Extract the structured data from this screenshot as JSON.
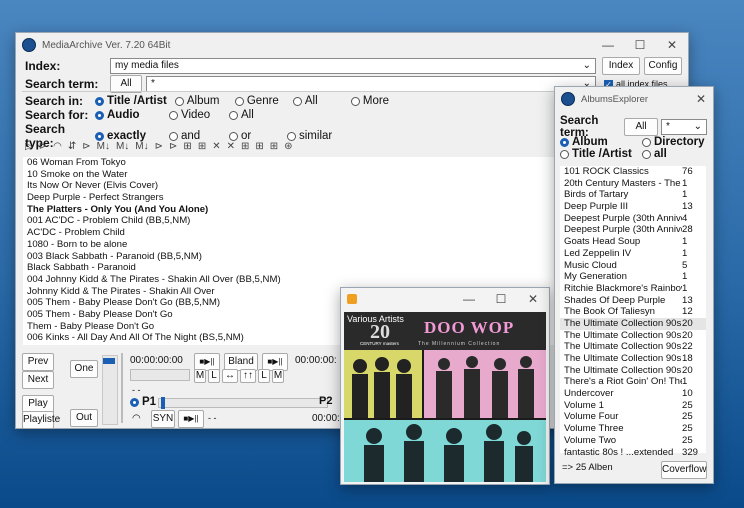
{
  "main": {
    "title": "MediaArchive Ver. 7.20 64Bit",
    "index_label": "Index:",
    "index_value": "my media files",
    "index_btn": "Index",
    "config_btn": "Config",
    "search_term_label": "Search term:",
    "all_btn": "All",
    "search_value": "*",
    "all_index_files": "all index files",
    "search_in_label": "Search in:",
    "search_for_label": "Search for:",
    "search_type_label": "Search type:",
    "search_in": [
      "Title /Artist",
      "Album",
      "Genre",
      "All",
      "More"
    ],
    "search_for": [
      "Audio",
      "Video",
      "All"
    ],
    "search_type": [
      "exactly",
      "and",
      "or",
      "similar"
    ],
    "toolbar_glyphs": [
      "▷",
      "⊳",
      "◠",
      "⇵",
      "⊳",
      "M↓",
      "M↓",
      "M↓",
      "⊳",
      "⊳",
      "⊞",
      "⊞",
      "✕",
      "✕",
      "⊞",
      "⊞",
      "⊞",
      "⊛"
    ],
    "results": [
      "06 Woman From Tokyo",
      "10 Smoke on the Water",
      "Its Now Or Never (Elvis Cover)",
      "Deep Purple - Perfect Strangers",
      "The Platters - Only You (And You Alone)",
      "001  AC'DC - Problem Child (BB,5,NM)",
      "AC'DC - Problem Child",
      "1080 - Born to be alone",
      "003  Black Sabbath - Paranoid (BB,5,NM)",
      "Black Sabbath - Paranoid",
      "004  Johnny Kidd & The Pirates - Shakin All Over (BB,5,NM)",
      "Johnny Kidd & The Pirates - Shakin All Over",
      "005  Them - Baby Please Don't Go (BB,5,NM)",
      "005  Them - Baby Please Don't Go",
      "Them - Baby Please Don't Go",
      "006  Kinks - All Day And All Of The Night (BS,5,NM)"
    ],
    "player": {
      "prev": "Prev",
      "next": "Next",
      "play": "Play",
      "playlist": "Playliste",
      "one": "One",
      "out": "Out",
      "time1": "00:00:00:00",
      "time2": "00:00:00:",
      "bland": "Bland",
      "m": "M",
      "l": "L",
      "lr": "↔",
      "up": "↑↑",
      "l2": "L",
      "m2": "M",
      "dashes": "- -",
      "p1": "P1",
      "p2": "P2",
      "syn": "SYN",
      "dashes2": "- -",
      "time3": "00:00:00:",
      "playpause": "■▶||"
    }
  },
  "albums": {
    "title": "AlbumsExplorer",
    "search_term_label": "Search term:",
    "all_btn": "All",
    "search_value": "*",
    "opt_album": "Album",
    "opt_directory": "Directory",
    "opt_title_artist": "Title /Artist",
    "opt_all": "all",
    "items": [
      [
        "101 ROCK Classics",
        "76"
      ],
      [
        "20th Century Masters - The Mille",
        "1"
      ],
      [
        "Birds of Tartary",
        "1"
      ],
      [
        "Deep Purple III",
        "13"
      ],
      [
        "Deepest Purple (30th Anniversa",
        "4"
      ],
      [
        "Deepest Purple (30th Anniversar",
        "28"
      ],
      [
        "Goats Head Soup",
        "1"
      ],
      [
        "Led Zeppelin IV",
        "1"
      ],
      [
        "Music Cloud",
        "5"
      ],
      [
        "My Generation",
        "1"
      ],
      [
        "Ritchie Blackmore's Rainbow",
        "1"
      ],
      [
        "Shades Of Deep Purple",
        "13"
      ],
      [
        "The Book Of Taliesyn",
        "12"
      ],
      [
        "The Ultimate Collection 90s Anth",
        "20"
      ],
      [
        "The Ultimate Collection 90s Anth",
        "20"
      ],
      [
        "The Ultimate Collection 90s Anth",
        "22"
      ],
      [
        "The Ultimate Collection 90s Anth",
        "18"
      ],
      [
        "The Ultimate Collection 90s Anth",
        "20"
      ],
      [
        "There's a Riot Goin' On! The Roc",
        "1"
      ],
      [
        "Undercover",
        "10"
      ],
      [
        "Volume 1",
        "25"
      ],
      [
        "Volume Four",
        "25"
      ],
      [
        "Volume Three",
        "25"
      ],
      [
        "Volume Two",
        "25"
      ],
      [
        "fantastic 80s ! ...extended",
        "329"
      ]
    ],
    "footer": "=> 25 Alben",
    "coverflow_btn": "Coverflow"
  },
  "cover": {
    "caption": "Various Artists",
    "big_num": "20",
    "century": "CENTURY masters",
    "doo_wop": "DOO WOP",
    "subtitle": "The Millennium Collection"
  }
}
